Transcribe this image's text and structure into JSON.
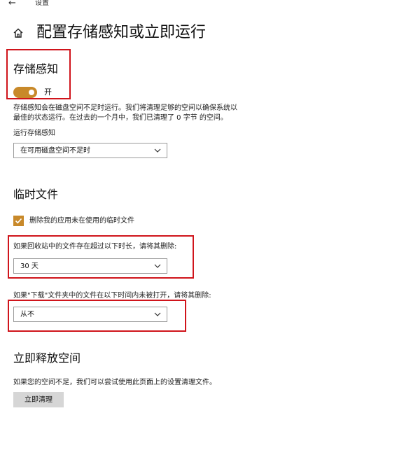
{
  "topbar": {
    "back_glyph": "←",
    "title": "设置"
  },
  "page": {
    "title": "配置存储感知或立即运行",
    "home_icon": "home-icon"
  },
  "storage_sense": {
    "heading": "存储感知",
    "toggle_state": "开",
    "toggle_on": true,
    "description_line1": "存储感知会在磁盘空间不足时运行。我们将清理足够的空间以确保系统以",
    "description_line2": "最佳的状态运行。在过去的一个月中，我们已清理了 0 字节 的空间。",
    "run_label": "运行存储感知",
    "run_value": "在可用磁盘空间不足时"
  },
  "temp_files": {
    "heading": "临时文件",
    "checkbox_label": "删除我的应用未在使用的临时文件",
    "checkbox_checked": true,
    "recycle_label": "如果回收站中的文件存在超过以下时长，请将其删除:",
    "recycle_value": "30 天",
    "downloads_label": "如果\"下载\"文件夹中的文件在以下时间内未被打开，请将其删除:",
    "downloads_value": "从不"
  },
  "free_space": {
    "heading": "立即释放空间",
    "description": "如果您的空间不足，我们可以尝试使用此页面上的设置清理文件。",
    "button_label": "立即清理"
  },
  "colors": {
    "accent": "#c8892a",
    "highlight": "#d0141b",
    "button_bg": "#d6d6d6"
  }
}
